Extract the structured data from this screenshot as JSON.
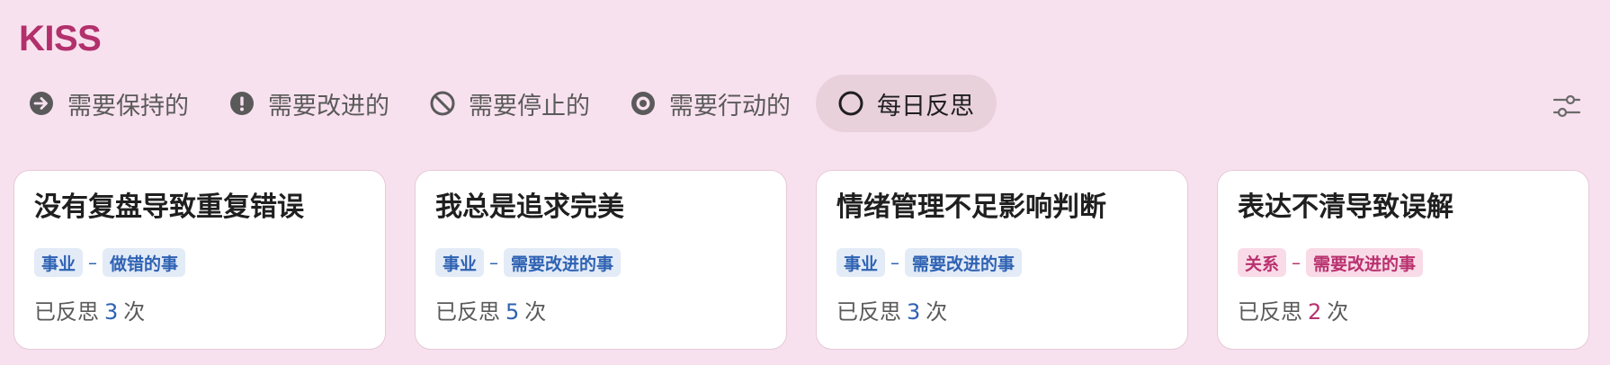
{
  "app": {
    "title": "KISS"
  },
  "tabs": [
    {
      "label": "需要保持的",
      "icon": "arrow-right-circle-icon"
    },
    {
      "label": "需要改进的",
      "icon": "exclamation-circle-icon"
    },
    {
      "label": "需要停止的",
      "icon": "prohibited-circle-icon"
    },
    {
      "label": "需要行动的",
      "icon": "target-circle-icon"
    },
    {
      "label": "每日反思",
      "icon": "ring-circle-icon",
      "active": true
    }
  ],
  "toolbar": {
    "settings_icon": "sliders-icon"
  },
  "cards": [
    {
      "title": "没有复盘导致重复错误",
      "category": "事业",
      "separator": "–",
      "subcategory": "做错的事",
      "count_prefix": "已反思",
      "count": "3",
      "count_suffix": "次",
      "color": "#2e62b3"
    },
    {
      "title": "我总是追求完美",
      "category": "事业",
      "separator": "–",
      "subcategory": "需要改进的事",
      "count_prefix": "已反思",
      "count": "5",
      "count_suffix": "次",
      "color": "#2e62b3"
    },
    {
      "title": "情绪管理不足影响判断",
      "category": "事业",
      "separator": "–",
      "subcategory": "需要改进的事",
      "count_prefix": "已反思",
      "count": "3",
      "count_suffix": "次",
      "color": "#2e62b3"
    },
    {
      "title": "表达不清导致误解",
      "category": "关系",
      "separator": "–",
      "subcategory": "需要改进的事",
      "count_prefix": "已反思",
      "count": "2",
      "count_suffix": "次",
      "color": "#b9316f"
    }
  ],
  "colors": {
    "background": "#f8e1ee",
    "brand": "#b2306c",
    "career_tag": "#2e62b3",
    "relation_tag": "#b9316f",
    "active_tab": "#e9d1dc"
  }
}
